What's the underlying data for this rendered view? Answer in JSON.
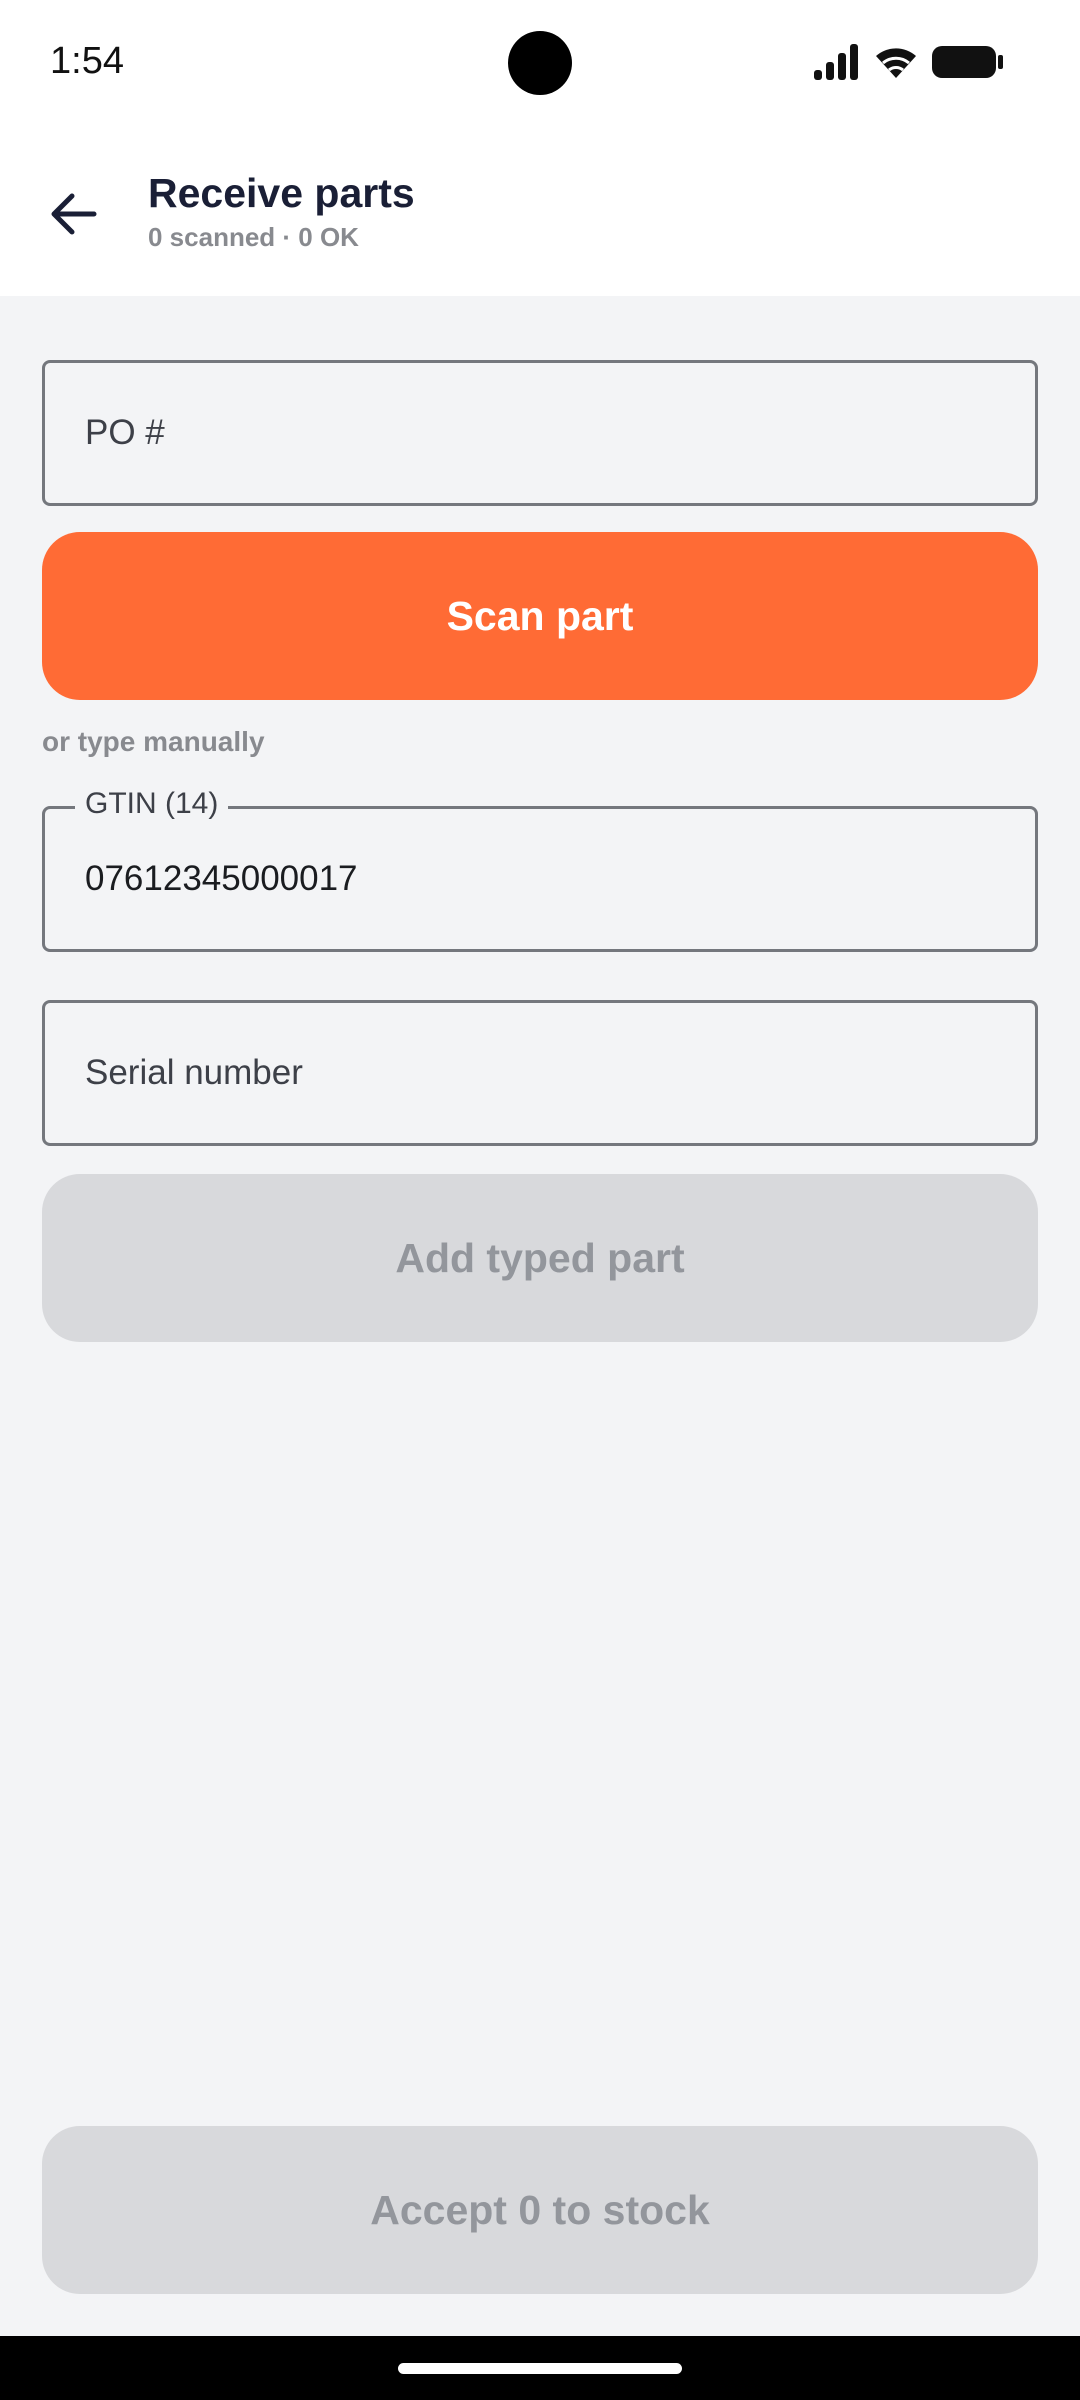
{
  "status_bar": {
    "time": "1:54",
    "icons": [
      "signal-icon",
      "wifi-icon",
      "battery-icon"
    ]
  },
  "app_bar": {
    "back_icon": "arrow-left-icon",
    "title": "Receive parts",
    "subtitle": "0 scanned · 0 OK"
  },
  "form": {
    "po_placeholder": "PO #",
    "scan_button_label": "Scan part",
    "manual_hint": "or type manually",
    "gtin_label": "GTIN (14)",
    "gtin_value": "07612345000017",
    "serial_placeholder": "Serial number",
    "add_button_label": "Add typed part"
  },
  "footer": {
    "accept_button_label": "Accept 0 to stock"
  },
  "colors": {
    "accent": "#ff6b35",
    "background": "#f3f4f6",
    "disabled": "#d8d9dc"
  }
}
